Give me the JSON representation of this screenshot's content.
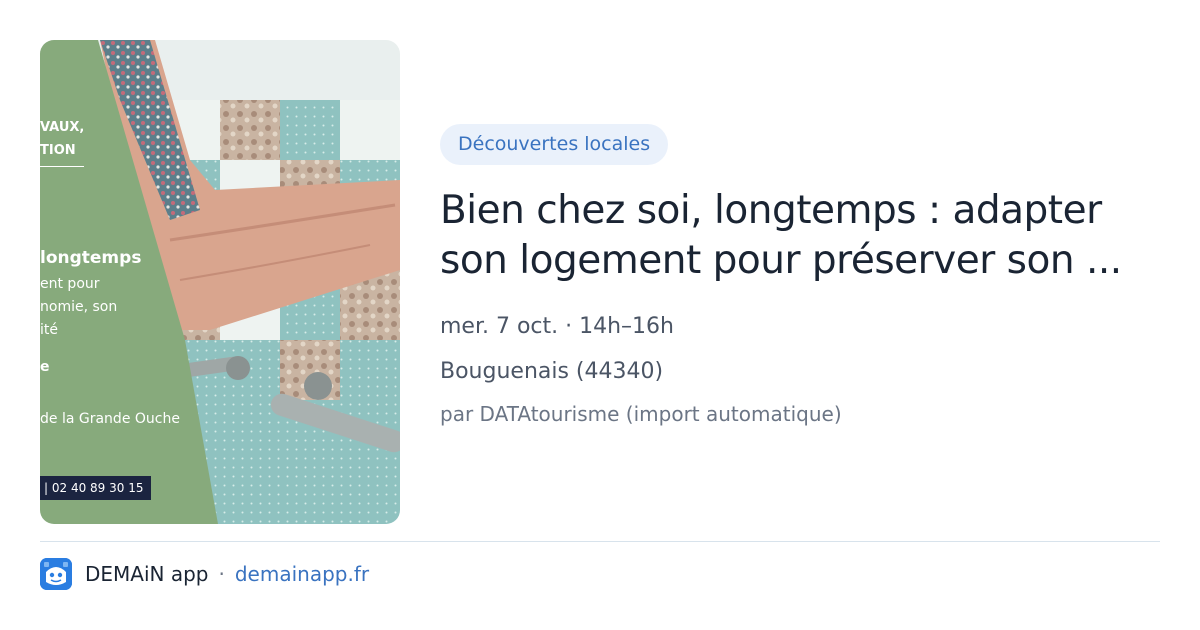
{
  "thumbnail": {
    "poster": {
      "line1": "VAUX,",
      "line2": "TION",
      "title": "longtemps",
      "sub1": "ent pour",
      "sub2": "nomie, son",
      "sub3": "ité",
      "highlight": "e",
      "place": "de la Grande Ouche",
      "phone": "| 02 40 89 30 15"
    },
    "colors": {
      "poster_green": "#87aa7c",
      "tile_teal": "#8fc2c0",
      "skin": "#d9a58e"
    }
  },
  "event": {
    "category": "Découvertes locales",
    "title_line1": "Bien chez soi, longtemps : adapter",
    "title_line2": "son logement pour préserver son ...",
    "date": "mer. 7 oct. · 14h–16h",
    "location": "Bouguenais (44340)",
    "source": "par DATAtourisme (import automatique)"
  },
  "footer": {
    "app_name": "DEMAiN app",
    "separator": "·",
    "domain": "demainapp.fr",
    "app_icon": "demain-app-icon"
  },
  "colors": {
    "accent": "#3a73c0",
    "tag_background": "#eaf1fb",
    "title": "#1a2433",
    "meta": "#4b5565"
  }
}
